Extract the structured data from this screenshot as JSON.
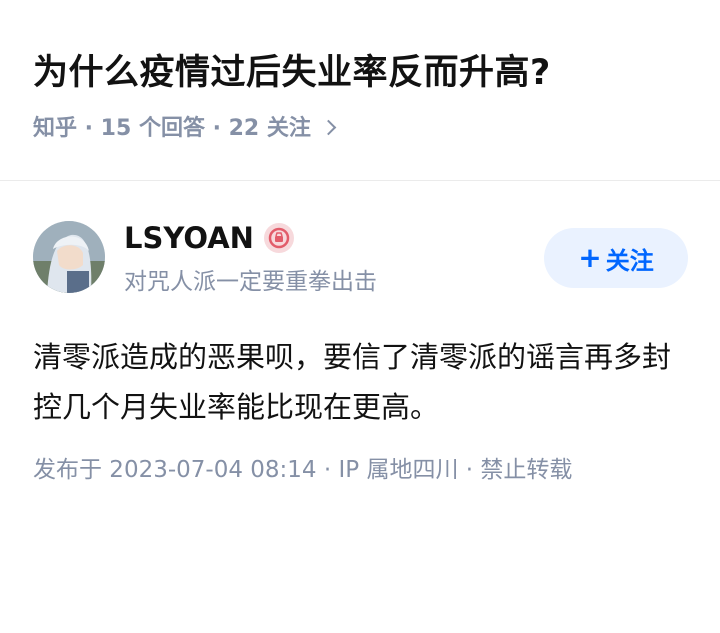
{
  "question": {
    "title": "为什么疫情过后失业率反而升高?",
    "meta": "知乎 · 15 个回答 · 22 关注"
  },
  "author": {
    "name": "LSYOAN",
    "bio": "对咒人派一定要重拳出击",
    "follow_label": "关注",
    "follow_prefix": "+"
  },
  "answer": {
    "text": "清零派造成的恶果呗，要信了清零派的谣言再多封控几个月失业率能比现在更高。",
    "meta": "发布于 2023-07-04 08:14 · IP 属地四川 · 禁止转载"
  },
  "colors": {
    "accent": "#0066ff",
    "muted": "#8590a6",
    "follow_bg": "#eaf2ff"
  }
}
